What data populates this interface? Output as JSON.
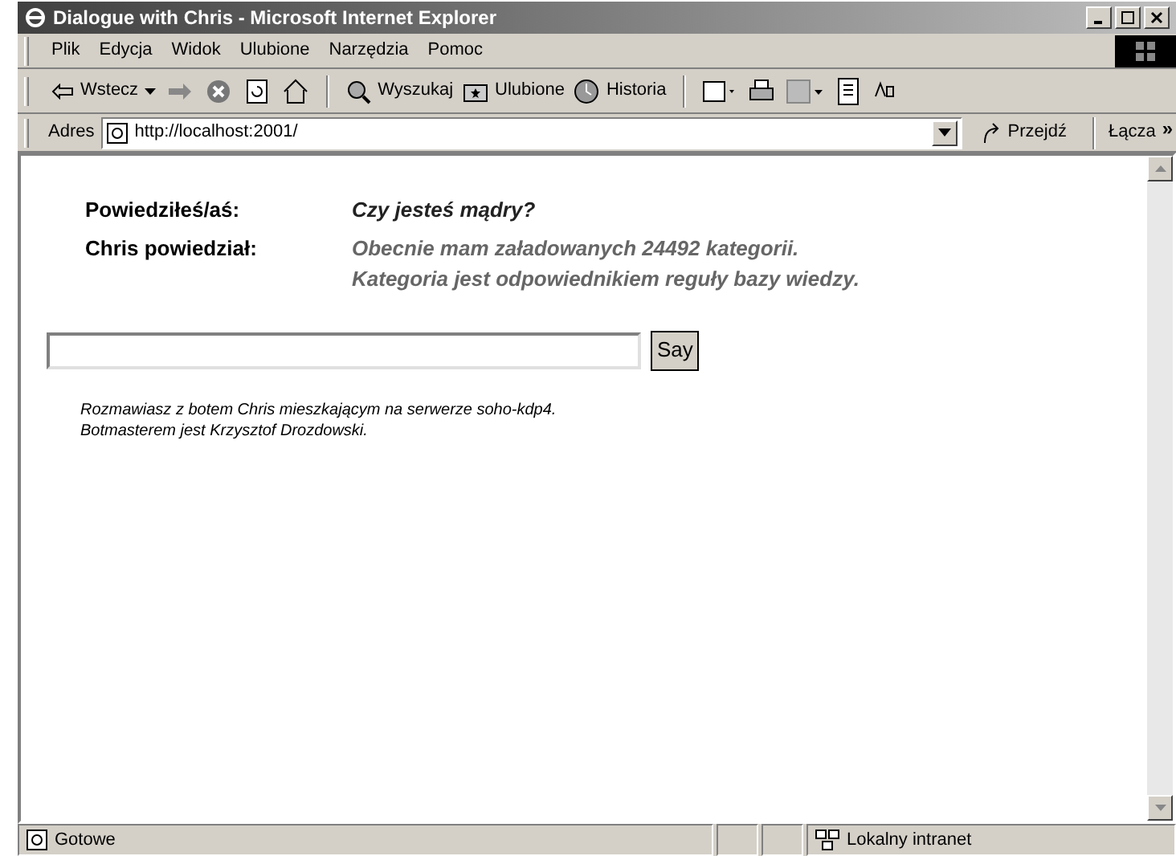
{
  "window": {
    "title": "Dialogue with Chris - Microsoft Internet Explorer"
  },
  "menu": [
    "Plik",
    "Edycja",
    "Widok",
    "Ulubione",
    "Narzędzia",
    "Pomoc"
  ],
  "toolbar": {
    "back": "Wstecz",
    "search": "Wyszukaj",
    "favorites": "Ulubione",
    "history": "Historia"
  },
  "address_bar": {
    "label": "Adres",
    "value": "http://localhost:2001/",
    "go": "Przejdź",
    "links": "Łącza",
    "more": "»"
  },
  "dialogue": [
    {
      "speaker": "Powiedziłeś/aś:",
      "text": "Czy jesteś mądry?",
      "kind": "user"
    },
    {
      "speaker": "Chris powiedział:",
      "text": "Obecnie mam załadowanych 24492 kategorii. Kategoria jest odpowiednikiem reguły bazy wiedzy.",
      "kind": "bot"
    }
  ],
  "say_button": "Say",
  "footer": [
    "Rozmawiasz z botem Chris mieszkającym na serwerze soho-kdp4.",
    "Botmasterem jest Krzysztof Drozdowski."
  ],
  "status_bar": {
    "text": "Gotowe",
    "zone": "Lokalny intranet"
  }
}
